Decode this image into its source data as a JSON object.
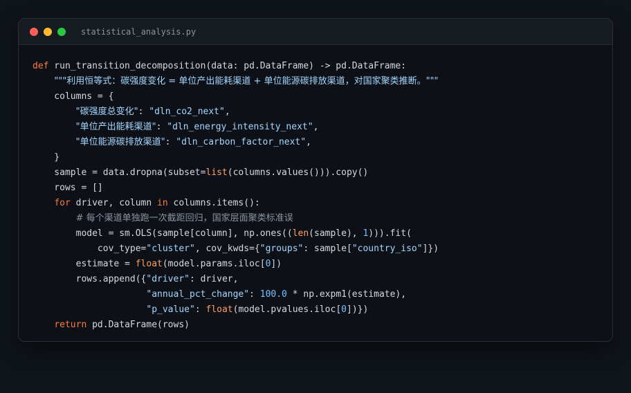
{
  "window": {
    "filename": "statistical_analysis.py",
    "traffic_lights": {
      "close": "#ff5f57",
      "minimize": "#febc2e",
      "maximize": "#28c840"
    }
  },
  "code": {
    "l1": {
      "def": "def",
      "name": " run_transition_decomposition",
      "rest": "(data: pd.DataFrame) -> pd.DataFrame:"
    },
    "l2": {
      "indent": "    ",
      "doc": "\"\"\"利用恒等式：碳强度变化 = 单位产出能耗渠道 + 单位能源碳排放渠道，对国家聚类推断。\"\"\""
    },
    "l3": {
      "text": "    columns = {"
    },
    "l4": {
      "indent": "        ",
      "key": "\"碳强度总变化\"",
      "sep": ": ",
      "val": "\"dln_co2_next\"",
      "end": ","
    },
    "l5": {
      "indent": "        ",
      "key": "\"单位产出能耗渠道\"",
      "sep": ": ",
      "val": "\"dln_energy_intensity_next\"",
      "end": ","
    },
    "l6": {
      "indent": "        ",
      "key": "\"单位能源碳排放渠道\"",
      "sep": ": ",
      "val": "\"dln_carbon_factor_next\"",
      "end": ","
    },
    "l7": {
      "text": "    }"
    },
    "l8": {
      "a": "    sample = data.dropna(subset=",
      "b": "list",
      "c": "(columns.values())).copy()"
    },
    "l9": {
      "text": "    rows = []"
    },
    "l10": {
      "a": "    ",
      "for": "for",
      "b": " driver, column ",
      "in": "in",
      "c": " columns.items():"
    },
    "l11": {
      "indent": "        ",
      "comment": "# 每个渠道单独跑一次截距回归，国家层面聚类标准误"
    },
    "l12": {
      "a": "        model = sm.OLS(sample[column], np.ones((",
      "len": "len",
      "b": "(sample), ",
      "one": "1",
      "c": "))).fit("
    },
    "l13": {
      "a": "            cov_type=",
      "s1": "\"cluster\"",
      "b": ", cov_kwds={",
      "s2": "\"groups\"",
      "c": ": sample[",
      "s3": "\"country_iso\"",
      "d": "]})"
    },
    "l14": {
      "a": "        estimate = ",
      "float": "float",
      "b": "(model.params.iloc[",
      "zero": "0",
      "c": "])"
    },
    "l15": {
      "a": "        rows.append({",
      "s1": "\"driver\"",
      "b": ": driver,"
    },
    "l16": {
      "a": "                     ",
      "s1": "\"annual_pct_change\"",
      "b": ": ",
      "num": "100.0",
      "c": " * np.expm1(estimate),"
    },
    "l17": {
      "a": "                     ",
      "s1": "\"p_value\"",
      "b": ": ",
      "float": "float",
      "c": "(model.pvalues.iloc[",
      "zero": "0",
      "d": "])})"
    },
    "l18": {
      "a": "    ",
      "ret": "return",
      "b": " pd.DataFrame(rows)"
    }
  }
}
